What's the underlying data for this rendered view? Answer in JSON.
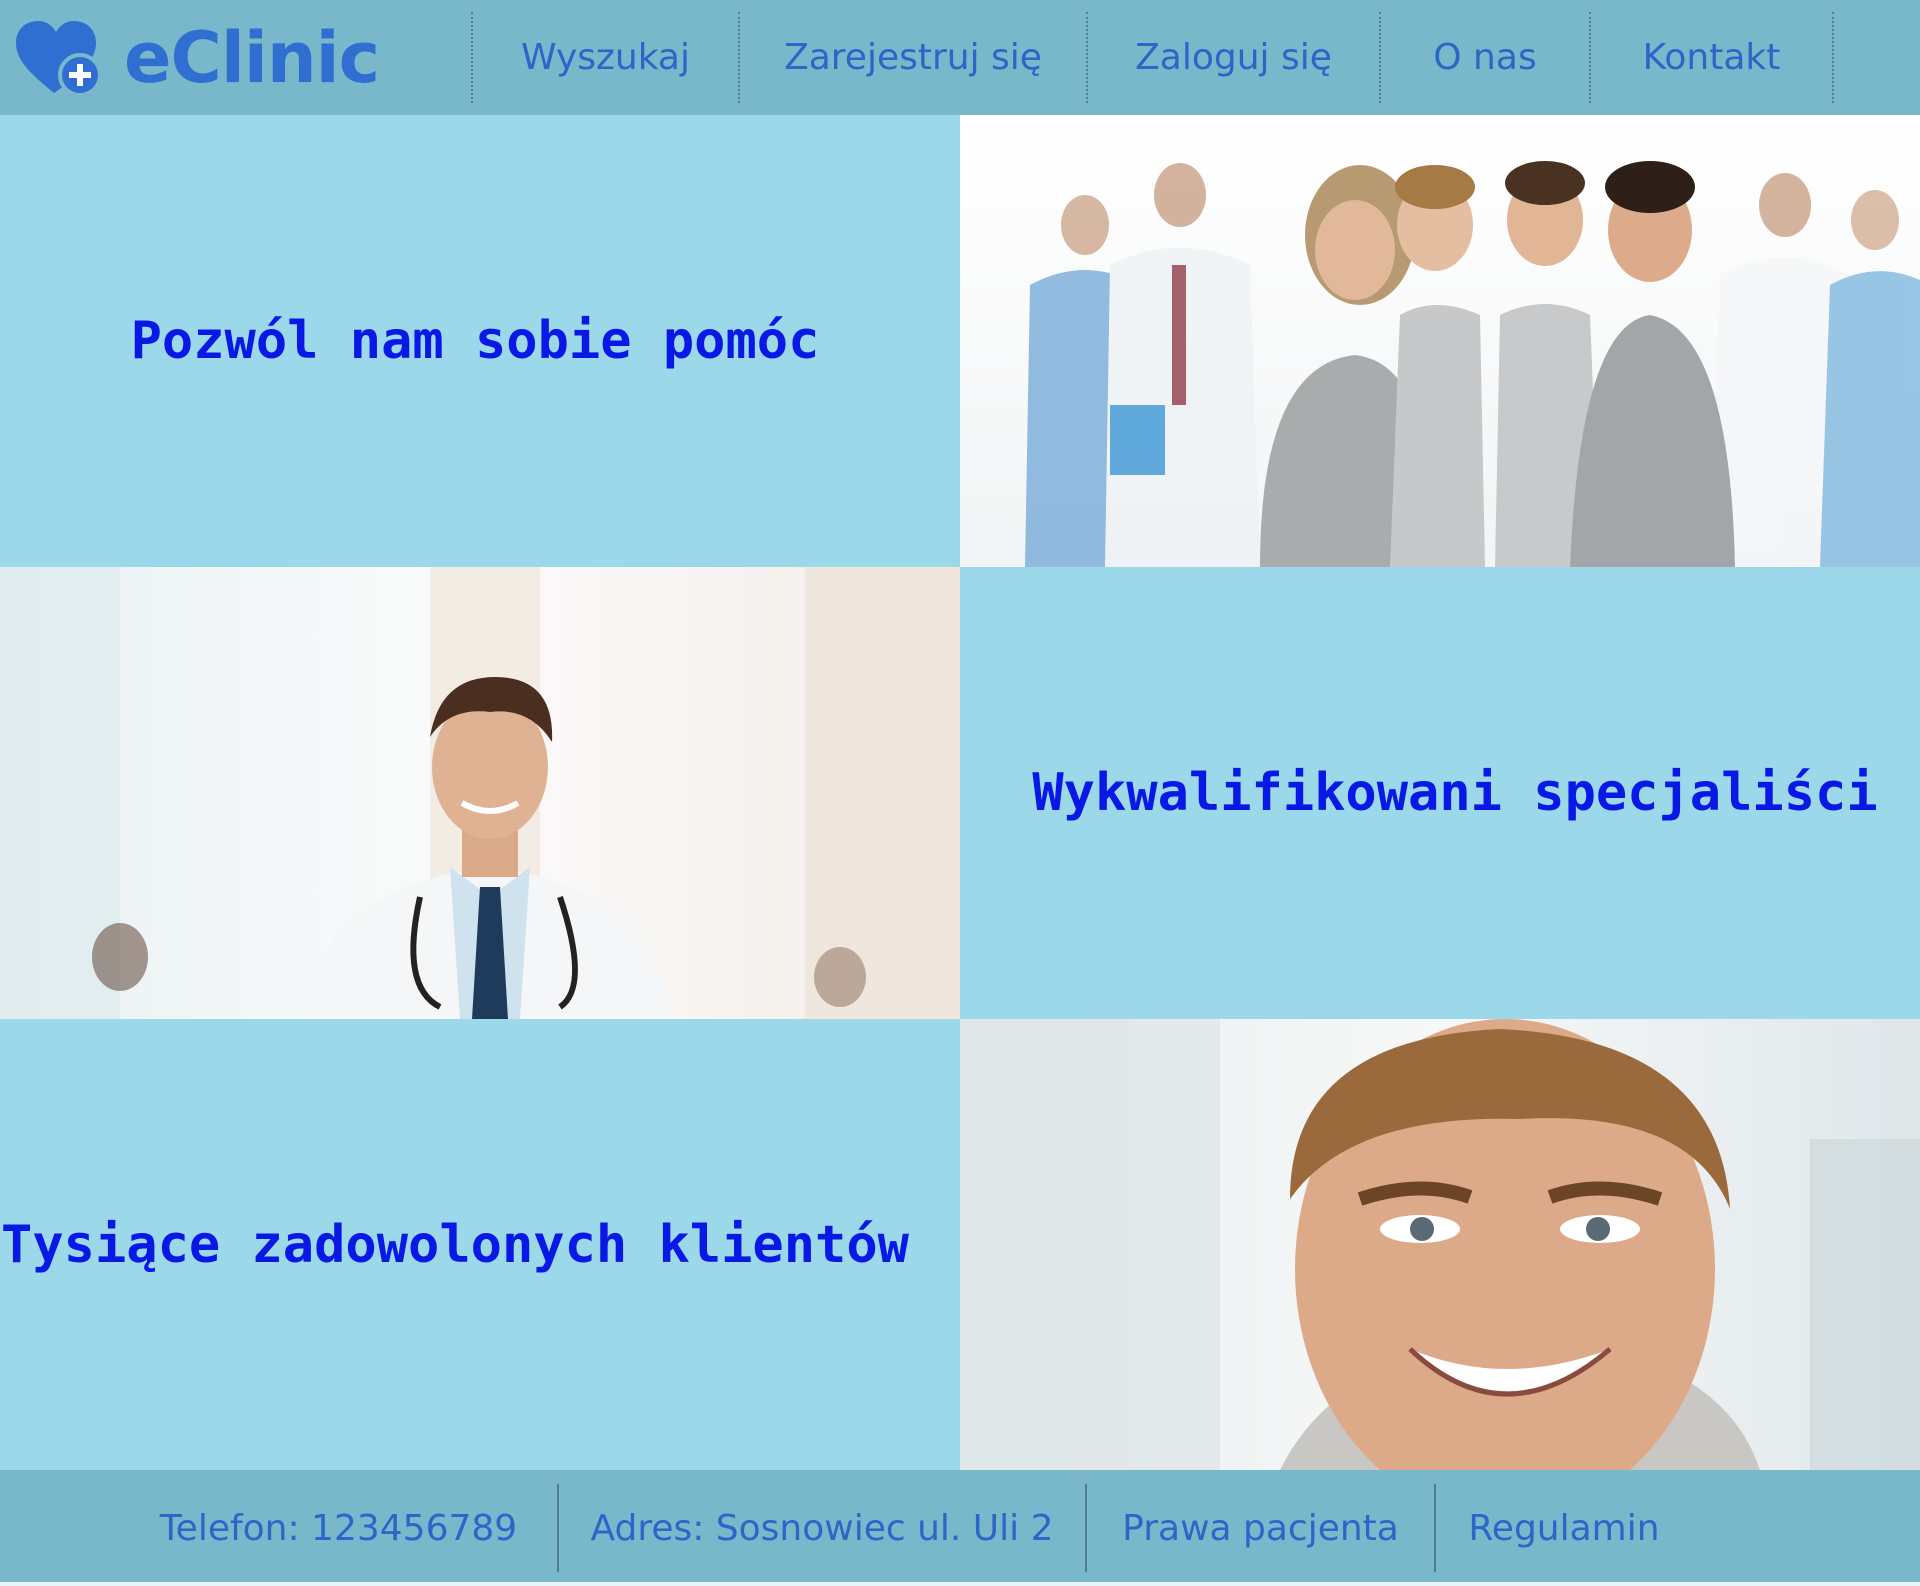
{
  "brand": {
    "name": "eClinic",
    "logo_icon": "heart-plus-icon",
    "color": "#2f6fd2"
  },
  "nav": {
    "items": [
      {
        "label": "Wyszukaj"
      },
      {
        "label": "Zarejestruj się"
      },
      {
        "label": "Zaloguj się"
      },
      {
        "label": "O nas"
      },
      {
        "label": "Kontakt"
      }
    ]
  },
  "sections": [
    {
      "headline": "Pozwól nam sobie pomóc",
      "image": "family-with-medical-staff-photo"
    },
    {
      "headline": "Wykwalifikowani specjaliści",
      "image": "smiling-doctor-photo"
    },
    {
      "headline": "Tysiące zadowolonych klientów",
      "image": "smiling-young-man-photo"
    }
  ],
  "footer": {
    "phone": "Telefon: 123456789",
    "address": "Adres: Sosnowiec ul. Uli 2",
    "patient_rights": "Prawa pacjenta",
    "terms": "Regulamin"
  },
  "colors": {
    "header_bg": "#79b8cb",
    "panel_bg": "#9bd8e9",
    "nav_text": "#2c66c8",
    "headline_text": "#0a18e6"
  }
}
